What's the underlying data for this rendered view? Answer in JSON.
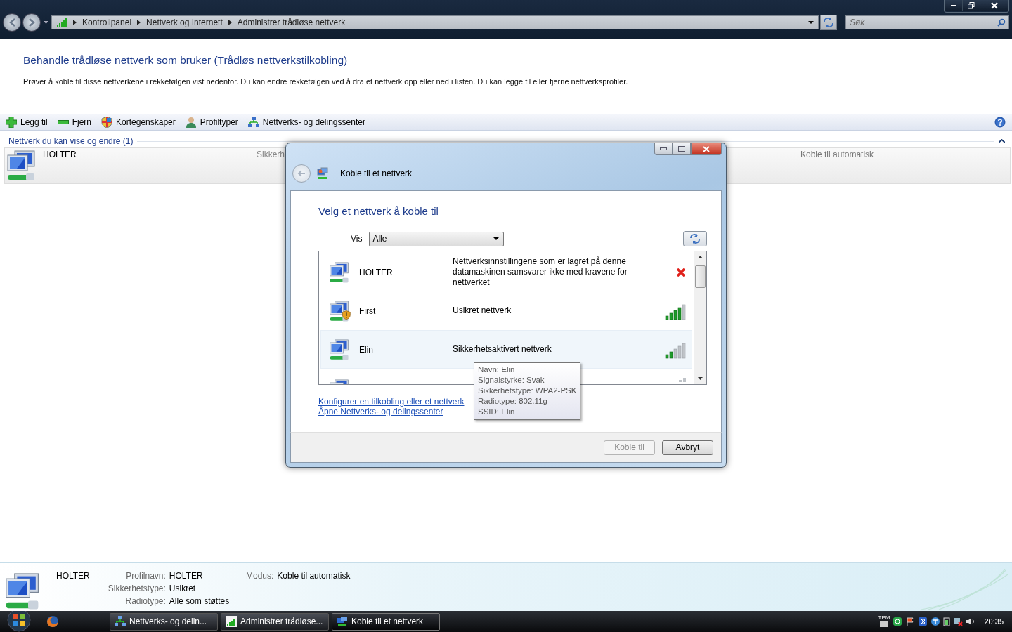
{
  "window": {
    "breadcrumbs": [
      "Kontrollpanel",
      "Nettverk og Internett",
      "Administrer trådløse nettverk"
    ],
    "search": {
      "placeholder": "Søk"
    }
  },
  "page": {
    "title": "Behandle trådløse nettverk som bruker (Trådløs nettverkstilkobling)",
    "description": "Prøver å koble til disse nettverkene i rekkefølgen vist nedenfor. Du kan endre rekkefølgen ved å dra et nettverk opp eller ned i listen. Du kan legge til eller fjerne nettverksprofiler."
  },
  "toolbar": [
    {
      "kind": "add",
      "label": "Legg til"
    },
    {
      "kind": "remove",
      "label": "Fjern"
    },
    {
      "kind": "shield",
      "label": "Kortegenskaper"
    },
    {
      "kind": "user",
      "label": "Profiltyper"
    },
    {
      "kind": "network",
      "label": "Nettverks- og delingssenter"
    }
  ],
  "group": {
    "title": "Nettverk du kan vise og endre (1)",
    "expanded": true,
    "rows": [
      {
        "name": "HOLTER",
        "security": "Sikkerh",
        "mode": "Koble til automatisk",
        "selected": true
      }
    ]
  },
  "dialog": {
    "title": "Koble til et nettverk",
    "heading": "Velg et nettverk å koble til",
    "filter_label": "Vis",
    "filter_value": "Alle",
    "networks": [
      {
        "kind": "error",
        "name": "HOLTER",
        "description": "Nettverksinnstillingene som er lagret på denne datamaskinen samsvarer ikke med kravene for nettverket",
        "warning": false,
        "hovered": false
      },
      {
        "kind": "strong",
        "name": "First",
        "description": "Usikret nettverk",
        "warning": true,
        "hovered": false
      },
      {
        "kind": "weak",
        "name": "Elin",
        "description": "Sikkerhetsaktivert nettverk",
        "warning": false,
        "hovered": true
      },
      {
        "kind": "partial"
      }
    ],
    "tooltip": [
      "Navn: Elin",
      "Signalstyrke: Svak",
      "Sikkerhetstype: WPA2-PSK",
      "Radiotype: 802.11g",
      "SSID: Elin"
    ],
    "links": [
      "Konfigurer en tilkobling eller et nettverk",
      "Åpne Nettverks- og delingssenter"
    ],
    "buttons": [
      {
        "label": "Koble til",
        "disabled": true
      },
      {
        "label": "Avbryt",
        "disabled": false
      }
    ]
  },
  "details": {
    "name": "HOLTER",
    "fields": [
      {
        "label": "Profilnavn:",
        "value": "HOLTER"
      },
      {
        "label": "Sikkerhetstype:",
        "value": "Usikret"
      },
      {
        "label": "Radiotype:",
        "value": "Alle som støttes"
      }
    ],
    "mode": {
      "label": "Modus:",
      "value": "Koble til automatisk"
    }
  },
  "taskbar": {
    "tasks": [
      {
        "kind": "network",
        "label": "Nettverks- og delin...",
        "selected": false
      },
      {
        "kind": "signal",
        "label": "Administrer trådløse...",
        "selected": false
      },
      {
        "kind": "connect",
        "label": "Koble til et nettverk",
        "selected": true
      }
    ],
    "tray_label": "TPM",
    "clock": "20:35"
  }
}
